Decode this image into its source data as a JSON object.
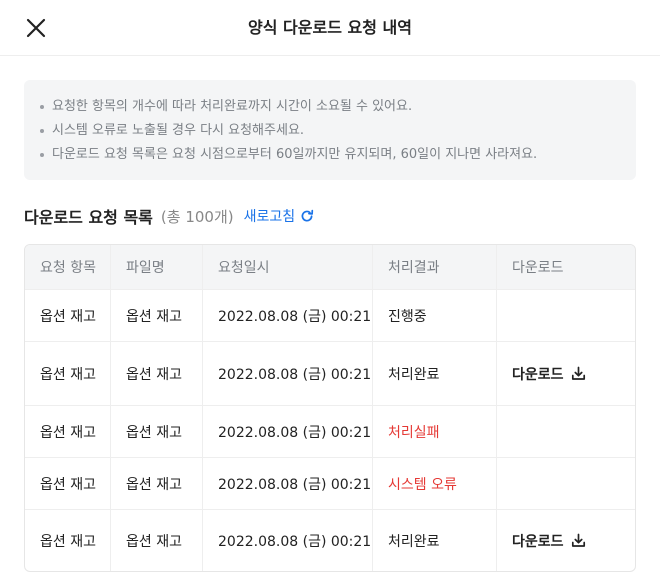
{
  "header": {
    "title": "양식 다운로드 요청 내역",
    "close_icon": "close-icon"
  },
  "notice": {
    "items": [
      "요청한 항목의 개수에 따라 처리완료까지 시간이 소요될 수 있어요.",
      "시스템 오류로 노출될 경우 다시 요청해주세요.",
      "다운로드 요청 목록은 요청 시점으로부터 60일까지만 유지되며, 60일이 지나면 사라져요."
    ]
  },
  "list": {
    "title": "다운로드 요청 목록",
    "count": "(총 100개)",
    "refresh_label": "새로고침",
    "refresh_icon": "refresh-icon"
  },
  "table": {
    "columns": [
      "요청 항목",
      "파일명",
      "요청일시",
      "처리결과",
      "다운로드"
    ],
    "rows": [
      {
        "item": "옵션 재고",
        "file": "옵션 재고",
        "date": "2022.08.08 (금) 00:21",
        "status": "진행중",
        "status_type": "normal",
        "download": ""
      },
      {
        "item": "옵션 재고",
        "file": "옵션 재고",
        "date": "2022.08.08 (금) 00:21",
        "status": "처리완료",
        "status_type": "normal",
        "download": "다운로드"
      },
      {
        "item": "옵션 재고",
        "file": "옵션 재고",
        "date": "2022.08.08 (금) 00:21",
        "status": "처리실패",
        "status_type": "error",
        "download": ""
      },
      {
        "item": "옵션 재고",
        "file": "옵션 재고",
        "date": "2022.08.08 (금) 00:21",
        "status": "시스템 오류",
        "status_type": "error",
        "download": ""
      },
      {
        "item": "옵션 재고",
        "file": "옵션 재고",
        "date": "2022.08.08 (금) 00:21",
        "status": "처리완료",
        "status_type": "normal",
        "download": "다운로드"
      }
    ]
  },
  "colors": {
    "accent": "#1a73e8",
    "error": "#e53935",
    "notice_bg": "#f4f5f6"
  }
}
